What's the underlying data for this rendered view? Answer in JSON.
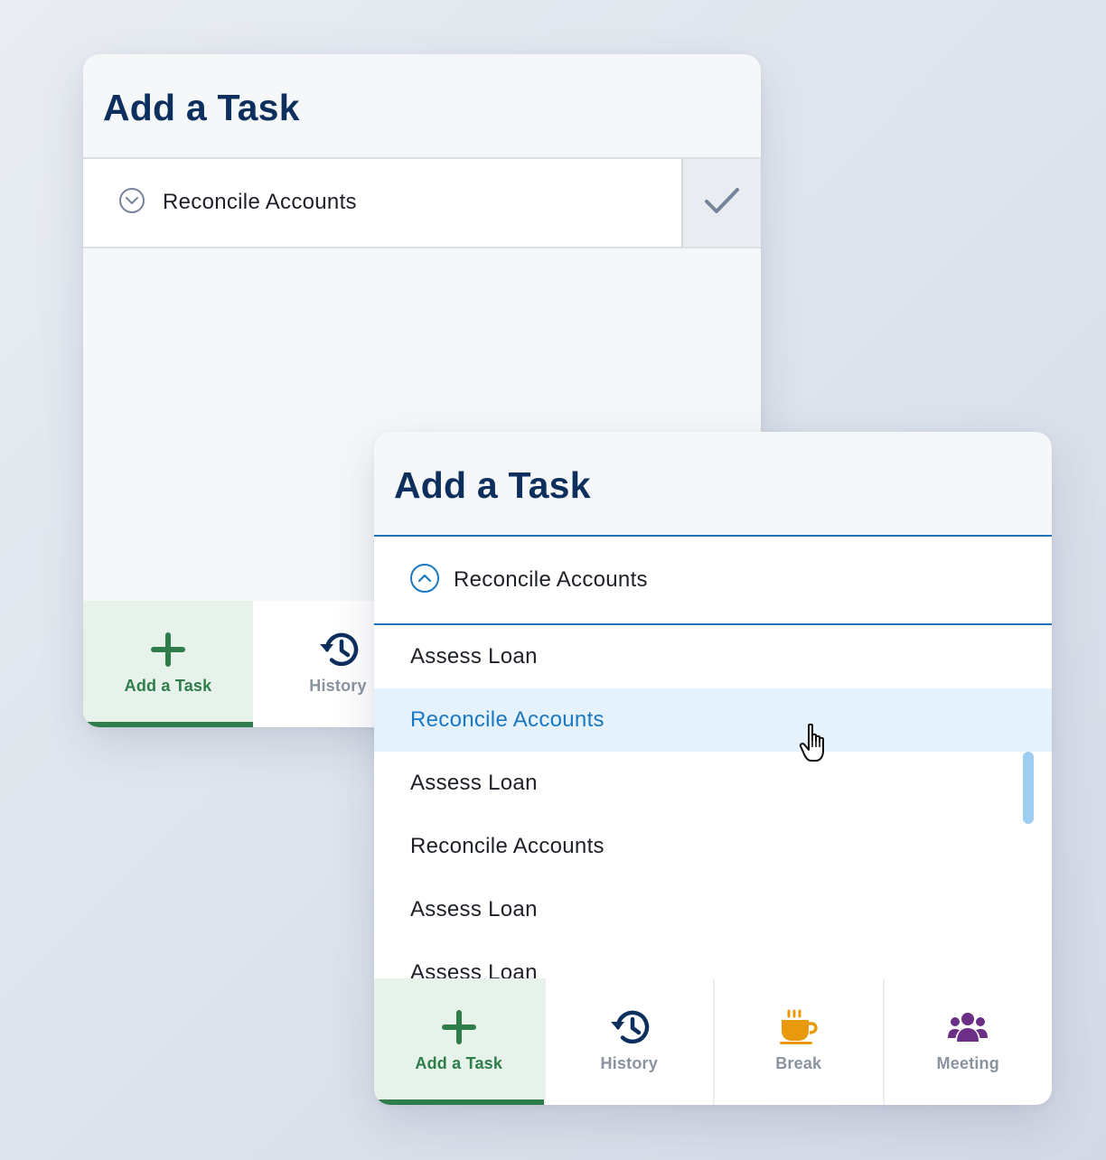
{
  "back_panel": {
    "title": "Add a Task",
    "select": {
      "value": "Reconcile Accounts",
      "chevron": "chevron-down-icon",
      "confirm_icon": "check-icon"
    },
    "nav": [
      {
        "label": "Add a Task",
        "icon": "plus-icon",
        "active": true
      },
      {
        "label": "History",
        "icon": "history-icon",
        "active": false
      }
    ]
  },
  "front_panel": {
    "title": "Add a Task",
    "select": {
      "value": "Reconcile Accounts",
      "chevron": "chevron-up-icon"
    },
    "options": [
      "Assess Loan",
      "Reconcile Accounts",
      "Assess Loan",
      "Reconcile Accounts",
      "Assess Loan",
      "Assess Loan"
    ],
    "highlighted_option": "Reconcile Accounts",
    "nav": [
      {
        "label": "Add a Task",
        "icon": "plus-icon",
        "active": true
      },
      {
        "label": "History",
        "icon": "history-icon",
        "active": false
      },
      {
        "label": "Break",
        "icon": "coffee-cup-icon",
        "active": false
      },
      {
        "label": "Meeting",
        "icon": "people-group-icon",
        "active": false
      }
    ]
  },
  "colors": {
    "title": "#0d2f5e",
    "accent_blue": "#1a78c2",
    "active_green": "#2e7d4a",
    "break_orange": "#e89a0c",
    "meeting_purple": "#6b2f86",
    "nav_dark": "#0d2f5e"
  }
}
